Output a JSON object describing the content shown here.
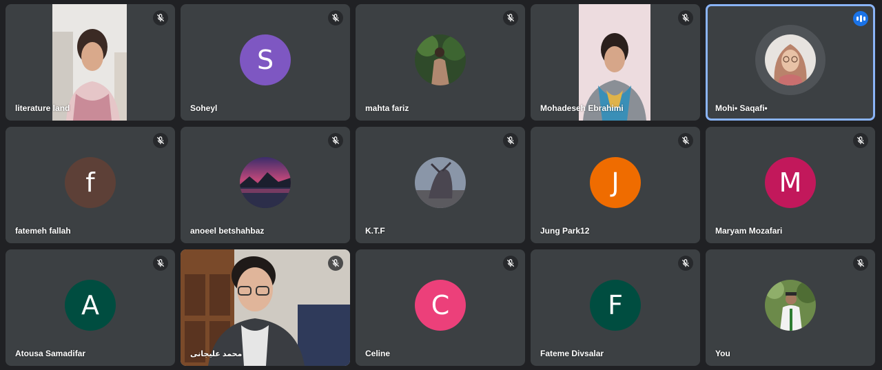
{
  "tiles": [
    {
      "name": "literature land",
      "kind": "video",
      "muted": true
    },
    {
      "name": "Soheyl",
      "kind": "letter",
      "letter": "S",
      "color": "#7e57c2",
      "muted": true
    },
    {
      "name": "mahta fariz",
      "kind": "photo",
      "muted": true
    },
    {
      "name": "Mohadeseh Ebrahimi",
      "kind": "video",
      "muted": true
    },
    {
      "name": "Mohi• Saqafi•",
      "kind": "photo",
      "speaking": true,
      "muted": false
    },
    {
      "name": "fatemeh fallah",
      "kind": "letter",
      "letter": "f",
      "color": "#5d4037",
      "muted": true
    },
    {
      "name": "anoeel betshahbaz",
      "kind": "photo",
      "muted": true
    },
    {
      "name": "K.T.F",
      "kind": "photo",
      "muted": true
    },
    {
      "name": "Jung Park12",
      "kind": "letter",
      "letter": "J",
      "color": "#ef6c00",
      "muted": true
    },
    {
      "name": "Maryam Mozafari",
      "kind": "letter",
      "letter": "M",
      "color": "#c2185b",
      "muted": true
    },
    {
      "name": "Atousa Samadifar",
      "kind": "letter",
      "letter": "A",
      "color": "#004d40",
      "muted": true
    },
    {
      "name": "محمد علیجانی",
      "kind": "video",
      "muted": true
    },
    {
      "name": "Celine",
      "kind": "letter",
      "letter": "C",
      "color": "#ec407a",
      "muted": true
    },
    {
      "name": "Fateme Divsalar",
      "kind": "letter",
      "letter": "F",
      "color": "#004d40",
      "muted": true
    },
    {
      "name": "You",
      "kind": "photo",
      "muted": true
    }
  ]
}
